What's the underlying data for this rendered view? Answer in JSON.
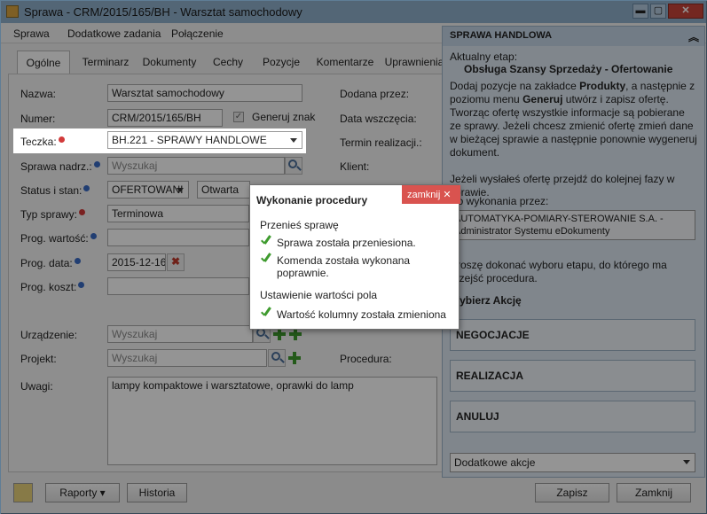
{
  "window": {
    "title": "Sprawa - CRM/2015/165/BH - Warsztat samochodowy",
    "close_label": "✕",
    "max_label": "▢",
    "min_label": "▬"
  },
  "menu": {
    "items": [
      "Sprawa",
      "Dodatkowe zadania",
      "Połączenie"
    ]
  },
  "tabs": [
    "Ogólne",
    "Terminarz",
    "Dokumenty",
    "Cechy",
    "Pozycje",
    "Komentarze",
    "Uprawnienia"
  ],
  "form": {
    "nazwa_label": "Nazwa:",
    "nazwa_value": "Warsztat samochodowy",
    "numer_label": "Numer:",
    "numer_value": "CRM/2015/165/BH",
    "generuj_label": "Generuj znak",
    "generuj_check": "✓",
    "teczka_label": "Teczka:",
    "teczka_value": "BH.221 - SPRAWY HANDLOWE",
    "sprawa_nadrz_label": "Sprawa nadrz.:",
    "sprawa_nadrz_placeholder": "Wyszukaj",
    "status_label": "Status i stan:",
    "status_value": "OFERTOWANI",
    "stan_value": "Otwarta",
    "typ_label": "Typ sprawy:",
    "typ_value": "Terminowa",
    "prog_wartosc_label": "Prog. wartość:",
    "prog_data_label": "Prog. data:",
    "prog_data_value": "2015-12-16",
    "prog_koszt_label": "Prog. koszt:",
    "urzadzenie_label": "Urządzenie:",
    "urzadzenie_placeholder": "Wyszukaj",
    "projekt_label": "Projekt:",
    "projekt_placeholder": "Wyszukaj",
    "uwagi_label": "Uwagi:",
    "uwagi_value": "lampy kompaktowe i warsztatowe, oprawki do lamp",
    "dodana_label": "Dodana przez:",
    "data_wszczecia_label": "Data wszczęcia:",
    "termin_label": "Termin realizacji.:",
    "klient_label": "Klient:",
    "procedura_label": "Procedura:"
  },
  "bottom": {
    "raporty": "Raporty",
    "historia": "Historia",
    "zapisz": "Zapisz",
    "zamknij": "Zamknij"
  },
  "side_panel": {
    "header": "SPRAWA HANDLOWA",
    "etap_label": "Aktualny etap:",
    "etap_value": "Obsługa Szansy Sprzedaży - Ofertowanie",
    "desc_1": "Dodaj pozycje na zakładce",
    "desc_bold_1": "Produkty",
    "desc_2": ", a następnie z poziomu menu",
    "desc_bold_2": "Generuj",
    "desc_3": "utwórz i zapisz ofertę. Tworząc ofertę wszystkie informacje są pobierane ze sprawy. Jeżeli chcesz zmienić ofertę zmień dane w bieżącej sprawie a następnie ponownie wygeneruj dokument.",
    "jezeli": "Jeżeli wysłałeś ofertę przejdź do kolejnej fazy w sprawie.",
    "wykonania_label": "Do wykonania przez:",
    "wykonania_1": "AUTOMATYKA-POMIARY-STEROWANIE S.A. -",
    "wykonania_2": "Administrator Systemu eDokumenty",
    "prosze": "Proszę dokonać wyboru etapu, do którego ma przejść procedura.",
    "wybierz": "Wybierz Akcję",
    "akcje": [
      "NEGOCJACJE",
      "REALIZACJA",
      "ANULUJ"
    ],
    "dodatkowe": "Dodatkowe akcje"
  },
  "modal": {
    "title": "Wykonanie procedury",
    "close_label": "zamknij ✕",
    "section_1": "Przenieś sprawę",
    "line_1": "Sprawa została przeniesiona.",
    "line_2": "Komenda została wykonana poprawnie.",
    "section_2": "Ustawienie wartości pola",
    "line_3": "Wartość kolumny została zmieniona"
  }
}
